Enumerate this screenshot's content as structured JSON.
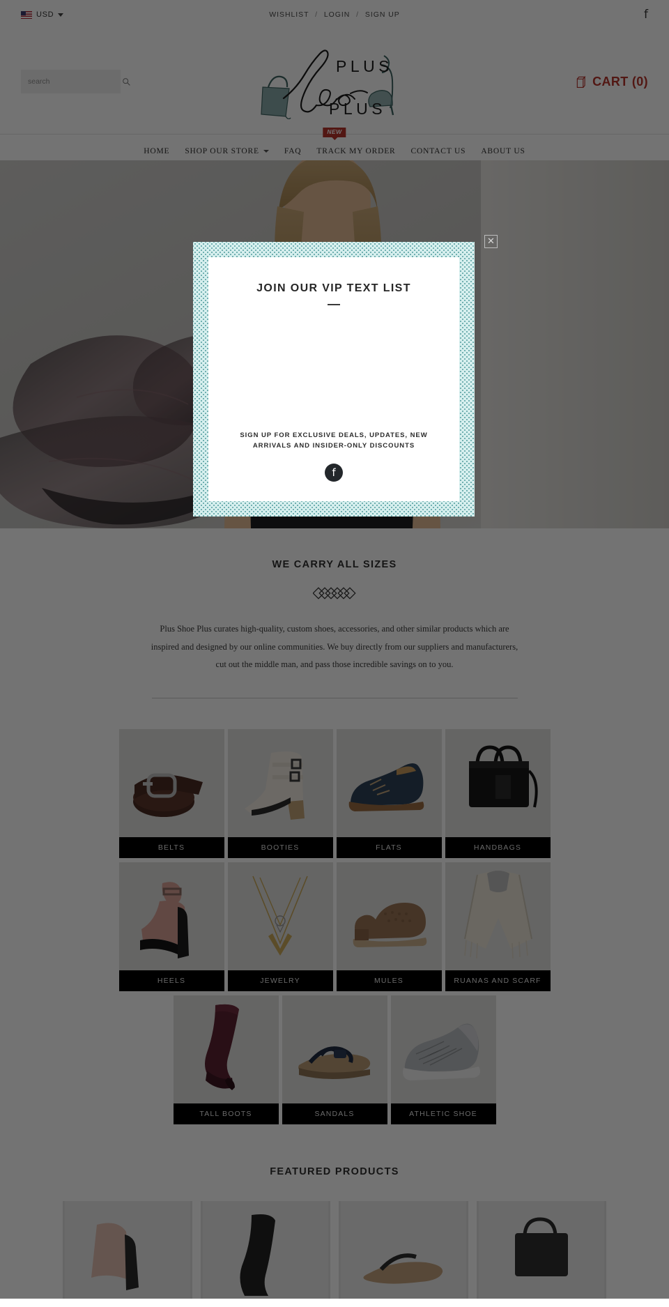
{
  "topbar": {
    "currency": "USD",
    "currency_icon": "us-flag-icon",
    "links": [
      {
        "label": "WISHLIST"
      },
      {
        "label": "LOGIN"
      },
      {
        "label": "SIGN UP"
      }
    ],
    "separator": "/",
    "social_icon": "facebook-icon",
    "social_glyph": "f"
  },
  "header": {
    "search_placeholder": "search",
    "search_value": "",
    "search_icon": "search-icon",
    "logo": {
      "line1": "PLUS",
      "line2": "Shoe",
      "line3": "PLUS",
      "alt": "Plus Shoe Plus",
      "color": "#5b8a89"
    },
    "cart_label": "CART (0)",
    "cart_icon": "shopping-bag-icon",
    "cart_color": "#b5332c"
  },
  "nav": {
    "badge": "NEW",
    "items": [
      {
        "label": "HOME",
        "has_dropdown": false
      },
      {
        "label": "SHOP OUR STORE",
        "has_dropdown": true
      },
      {
        "label": "FAQ",
        "has_dropdown": false
      },
      {
        "label": "TRACK MY ORDER",
        "has_dropdown": false
      },
      {
        "label": "CONTACT US",
        "has_dropdown": false
      },
      {
        "label": "ABOUT US",
        "has_dropdown": false
      }
    ]
  },
  "hero": {
    "alt": "Woman in black dress with sheer pink and black scarf"
  },
  "intro": {
    "title": "WE CARRY ALL SIZES",
    "ornament": "diamond-chain-divider",
    "body": "Plus Shoe Plus curates high-quality, custom shoes, accessories, and other similar products which are inspired and designed by our online communities. We buy directly from our suppliers and manufacturers, cut out the middle man, and pass those incredible savings on to you."
  },
  "categories": {
    "rows": [
      [
        {
          "label": "BELTS",
          "image": "brown-leather-belt"
        },
        {
          "label": "BOOTIES",
          "image": "white-ankle-boot"
        },
        {
          "label": "FLATS",
          "image": "navy-suede-oxford"
        },
        {
          "label": "HANDBAGS",
          "image": "black-tote-handbag"
        }
      ],
      [
        {
          "label": "HEELS",
          "image": "pink-platform-heel"
        },
        {
          "label": "JEWELRY",
          "image": "gold-layered-necklace"
        },
        {
          "label": "MULES",
          "image": "tan-woven-mule"
        },
        {
          "label": "RUANAS AND SCARF",
          "image": "cream-fringe-ruana"
        }
      ],
      [
        {
          "label": "TALL BOOTS",
          "image": "burgundy-tall-boot"
        },
        {
          "label": "SANDALS",
          "image": "navy-thong-sandal"
        },
        {
          "label": "ATHLETIC SHOE",
          "image": "grey-knit-sneaker"
        }
      ]
    ]
  },
  "featured": {
    "title": "FEATURED PRODUCTS",
    "items": [
      {
        "image": "nude-heel-product"
      },
      {
        "image": "black-boot-product"
      },
      {
        "image": "sandal-product"
      },
      {
        "image": "bag-product"
      }
    ]
  },
  "modal": {
    "title": "JOIN OUR VIP TEXT LIST",
    "subtitle": "SIGN UP FOR EXCLUSIVE DEALS, UPDATES, NEW ARRIVALS AND INSIDER-ONLY DISCOUNTS",
    "social_icon": "facebook-icon",
    "social_glyph": "f",
    "close_label": "✕",
    "border_color": "#d6efee",
    "dot_color": "#4e9a9c"
  }
}
